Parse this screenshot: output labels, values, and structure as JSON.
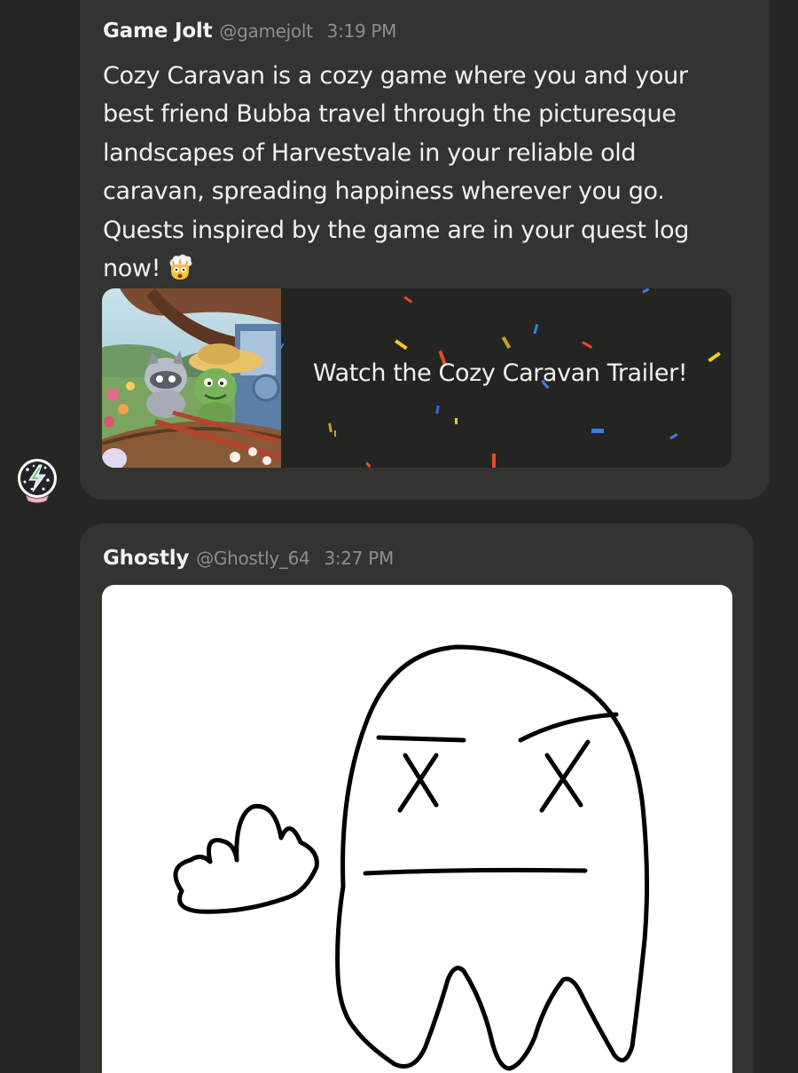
{
  "posts": [
    {
      "author": "Game Jolt",
      "handle": "@gamejolt",
      "time": "3:19 PM",
      "body": "Cozy Caravan is a cozy game where you and your best friend Bubba travel through the picturesque landscapes of Harvestvale in your reliable old caravan, spreading happiness wherever you go. Quests inspired by the game are in your quest log now!",
      "emoji": "exploding-head",
      "link_title": "Watch the Cozy Caravan Trailer!"
    },
    {
      "author": "Ghostly",
      "handle": "@Ghostly_64",
      "time": "3:27 PM",
      "image": "ghost-drawing"
    }
  ],
  "avatar_icon": "lightning-bolt-snow-globe-icon",
  "colors": {
    "background": "#262624",
    "card": "#33332f",
    "text": "#f1f1ee",
    "muted": "#8e8e8a"
  }
}
